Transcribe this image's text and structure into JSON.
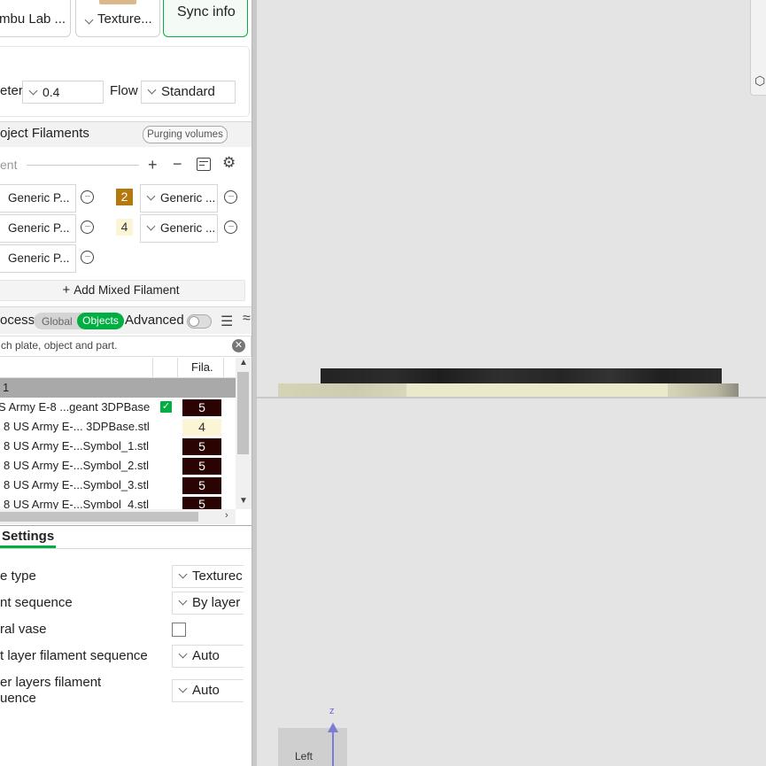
{
  "top_buttons": {
    "printer_label": "mbu Lab ...",
    "plate_label": "Texture...",
    "sync_label": "Sync info"
  },
  "nozzle": {
    "diameter_label": "eter",
    "diameter_value": "0.4",
    "flow_label": "Flow",
    "flow_value": "Standard"
  },
  "filaments": {
    "title": "oject Filaments",
    "purging_label": "Purging volumes",
    "toolbar_label": "ent",
    "items": [
      {
        "left": "Generic P...",
        "index": "2",
        "right": "Generic ..."
      },
      {
        "left": "Generic P...",
        "index": "4",
        "right": "Generic ..."
      },
      {
        "left": "Generic P..."
      }
    ],
    "index_colors": [
      "#b5780f",
      "#fbf5d6"
    ],
    "add_mixed_label": "Add Mixed Filament"
  },
  "process": {
    "title": "ocess",
    "global_label": "Global",
    "objects_label": "Objects",
    "advanced_label": "Advanced",
    "search_placeholder": "ch plate, object and part."
  },
  "object_table": {
    "fila_header": "Fila.",
    "plate_row": "1",
    "rows": [
      {
        "name": "S Army E-8 ...geant 3DPBase",
        "fila": "5",
        "checked": true
      },
      {
        "name": "8 US Army E-... 3DPBase.stl",
        "fila": "4"
      },
      {
        "name": "8 US Army E-...Symbol_1.stl",
        "fila": "5"
      },
      {
        "name": "8 US Army E-...Symbol_2.stl",
        "fila": "5"
      },
      {
        "name": "8 US Army E-...Symbol_3.stl",
        "fila": "5"
      },
      {
        "name": "8 US Army E-...Symbol_4.stl",
        "fila": "5"
      }
    ]
  },
  "settings": {
    "tab_label": "Settings",
    "items": [
      {
        "label": "e type",
        "value": "Texturec"
      },
      {
        "label": "nt sequence",
        "value": "By layer"
      },
      {
        "label": "ral vase",
        "value": ""
      },
      {
        "label": "t layer filament sequence",
        "value": "Auto"
      },
      {
        "label": "er layers filament",
        "label2": "uence",
        "value": "Auto"
      }
    ]
  },
  "viewport": {
    "view_label": "Left",
    "axis_label": "z"
  },
  "colors": {
    "accent": "#00ae42",
    "dark_fila": "#2a0303",
    "light_fila": "#fbf5d6"
  }
}
